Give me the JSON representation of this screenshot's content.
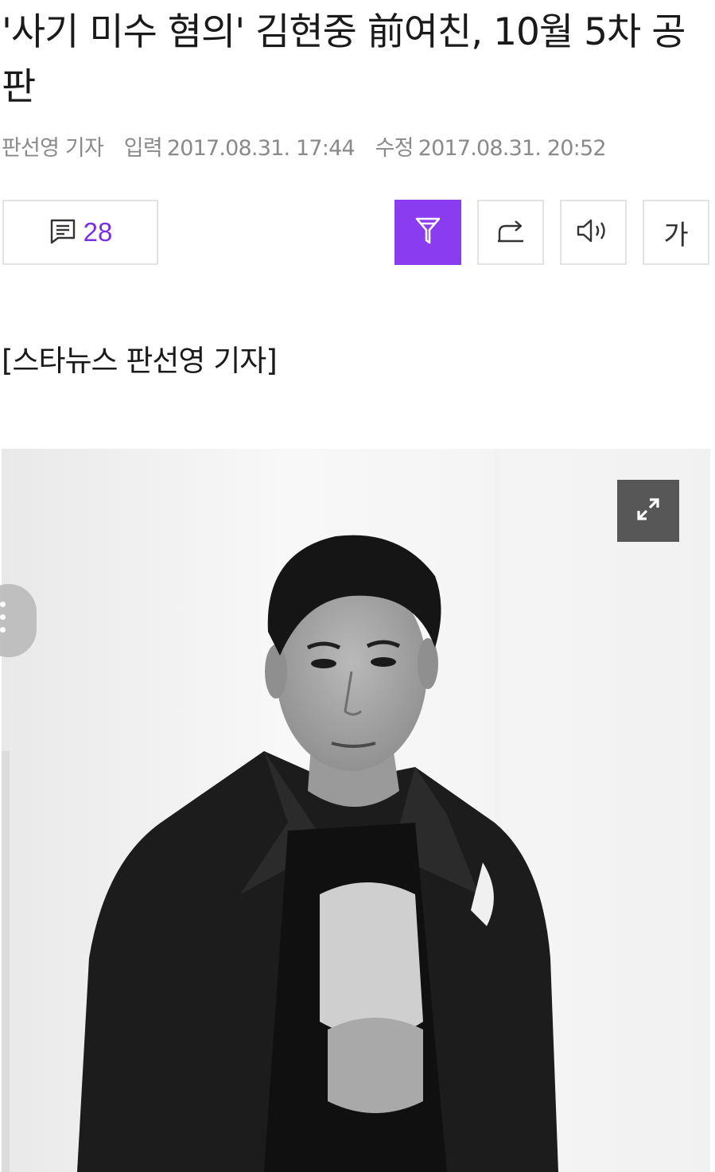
{
  "article": {
    "headline": "'사기 미수 혐의' 김현중 前여친, 10월 5차 공판",
    "reporter": "판선영 기자",
    "input_label": "입력",
    "input_time": "2017.08.31. 17:44",
    "modified_label": "수정",
    "modified_time": "2017.08.31. 20:52",
    "source_line": "[스타뉴스 판선영 기자]"
  },
  "toolbar": {
    "comment_count": "28",
    "font_button_label": "가",
    "icons": [
      "comment-icon",
      "filter-icon",
      "share-icon",
      "speaker-icon"
    ]
  },
  "colors": {
    "accent": "#8a3cf0",
    "comment_count": "#7b2fe3",
    "meta_text": "#8a8a8a",
    "border": "#e2e2e2"
  },
  "photo": {
    "description_icon": "expand-icon"
  }
}
